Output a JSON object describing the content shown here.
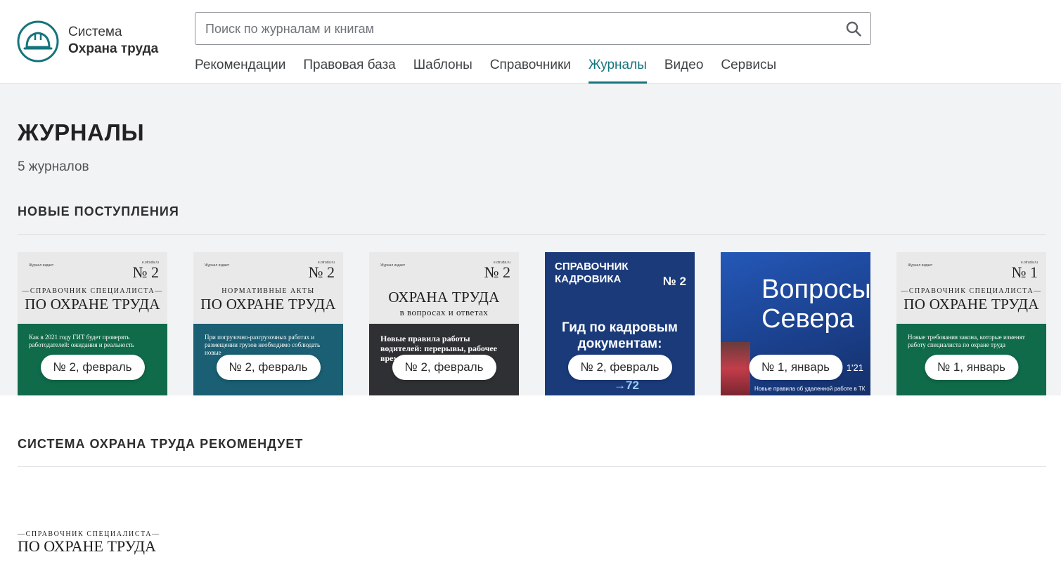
{
  "header": {
    "logo_line1": "Система",
    "logo_line2": "Охрана труда",
    "search_placeholder": "Поиск по журналам и книгам",
    "nav": [
      {
        "label": "Рекомендации",
        "active": false
      },
      {
        "label": "Правовая база",
        "active": false
      },
      {
        "label": "Шаблоны",
        "active": false
      },
      {
        "label": "Справочники",
        "active": false
      },
      {
        "label": "Журналы",
        "active": true
      },
      {
        "label": "Видео",
        "active": false
      },
      {
        "label": "Сервисы",
        "active": false
      }
    ]
  },
  "main": {
    "title": "ЖУРНАЛЫ",
    "count": "5 журналов",
    "new_section": "НОВЫЕ ПОСТУПЛЕНИЯ",
    "recommend_section": "СИСТЕМА ОХРАНА ТРУДА РЕКОМЕНДУЕТ"
  },
  "covers": [
    {
      "badge": "№ 2, февраль",
      "num": "№ 2",
      "kicker": "—СПРАВОЧНИК СПЕЦИАЛИСТА—",
      "title": "ПО ОХРАНЕ ТРУДА",
      "bottom_color": "#0f6b4a",
      "lines": [
        "Как в 2021 году ГИТ будет проверять работодателей: ожидания и реальность"
      ]
    },
    {
      "badge": "№ 2, февраль",
      "num": "№ 2",
      "kicker": "НОРМАТИВНЫЕ АКТЫ",
      "title": "ПО ОХРАНЕ ТРУДА",
      "bottom_color": "#1a5f73",
      "lines": [
        "При погрузочно-разгрузочных работах и размещении грузов необходимо соблюдать новые"
      ]
    },
    {
      "badge": "№ 2, февраль",
      "num": "№ 2",
      "kicker": "",
      "title": "ОХРАНА ТРУДА",
      "subtitle": "в вопросах и ответах",
      "bottom_color": "#2f3033",
      "lines": [
        "Новые правила работы водителей: перерывы, рабочее время и путевые"
      ]
    },
    {
      "badge": "№ 2, февраль",
      "num": "№ 2",
      "kicker": "",
      "title": "СПРАВОЧНИК КАДРОВИКА",
      "bottom_color": "#1a3a7a",
      "lines": [
        "Гид по кадровым документам:"
      ]
    },
    {
      "badge": "№ 1, январь",
      "num": "",
      "kicker": "",
      "title": "Вопросы Севера",
      "bottom_color": "#1a3f8a",
      "lines": [
        "Новые правила об удаленной работе в ТК"
      ]
    },
    {
      "badge": "№ 1, январь",
      "num": "№ 1",
      "kicker": "—СПРАВОЧНИК СПЕЦИАЛИСТА—",
      "title": "ПО ОХРАНЕ ТРУДА",
      "bottom_color": "#0f6b4a",
      "lines": [
        "Новые требования закона, которые изменят работу специалиста по охране труда"
      ]
    }
  ],
  "bottom_logo": {
    "kicker": "—СПРАВОЧНИК СПЕЦИАЛИСТА—",
    "title": "ПО ОХРАНЕ ТРУДА"
  },
  "colors": {
    "accent": "#16747c",
    "band": "#f2f3f5"
  }
}
